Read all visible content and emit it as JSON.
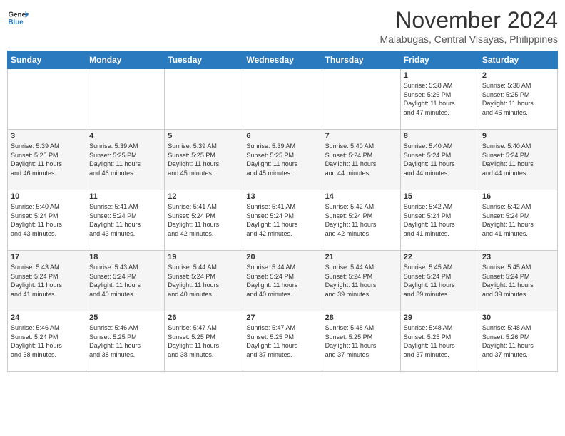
{
  "header": {
    "logo_line1": "General",
    "logo_line2": "Blue",
    "month": "November 2024",
    "location": "Malabugas, Central Visayas, Philippines"
  },
  "days_of_week": [
    "Sunday",
    "Monday",
    "Tuesday",
    "Wednesday",
    "Thursday",
    "Friday",
    "Saturday"
  ],
  "weeks": [
    [
      {
        "day": "",
        "info": ""
      },
      {
        "day": "",
        "info": ""
      },
      {
        "day": "",
        "info": ""
      },
      {
        "day": "",
        "info": ""
      },
      {
        "day": "",
        "info": ""
      },
      {
        "day": "1",
        "info": "Sunrise: 5:38 AM\nSunset: 5:26 PM\nDaylight: 11 hours\nand 47 minutes."
      },
      {
        "day": "2",
        "info": "Sunrise: 5:38 AM\nSunset: 5:25 PM\nDaylight: 11 hours\nand 46 minutes."
      }
    ],
    [
      {
        "day": "3",
        "info": "Sunrise: 5:39 AM\nSunset: 5:25 PM\nDaylight: 11 hours\nand 46 minutes."
      },
      {
        "day": "4",
        "info": "Sunrise: 5:39 AM\nSunset: 5:25 PM\nDaylight: 11 hours\nand 46 minutes."
      },
      {
        "day": "5",
        "info": "Sunrise: 5:39 AM\nSunset: 5:25 PM\nDaylight: 11 hours\nand 45 minutes."
      },
      {
        "day": "6",
        "info": "Sunrise: 5:39 AM\nSunset: 5:25 PM\nDaylight: 11 hours\nand 45 minutes."
      },
      {
        "day": "7",
        "info": "Sunrise: 5:40 AM\nSunset: 5:24 PM\nDaylight: 11 hours\nand 44 minutes."
      },
      {
        "day": "8",
        "info": "Sunrise: 5:40 AM\nSunset: 5:24 PM\nDaylight: 11 hours\nand 44 minutes."
      },
      {
        "day": "9",
        "info": "Sunrise: 5:40 AM\nSunset: 5:24 PM\nDaylight: 11 hours\nand 44 minutes."
      }
    ],
    [
      {
        "day": "10",
        "info": "Sunrise: 5:40 AM\nSunset: 5:24 PM\nDaylight: 11 hours\nand 43 minutes."
      },
      {
        "day": "11",
        "info": "Sunrise: 5:41 AM\nSunset: 5:24 PM\nDaylight: 11 hours\nand 43 minutes."
      },
      {
        "day": "12",
        "info": "Sunrise: 5:41 AM\nSunset: 5:24 PM\nDaylight: 11 hours\nand 42 minutes."
      },
      {
        "day": "13",
        "info": "Sunrise: 5:41 AM\nSunset: 5:24 PM\nDaylight: 11 hours\nand 42 minutes."
      },
      {
        "day": "14",
        "info": "Sunrise: 5:42 AM\nSunset: 5:24 PM\nDaylight: 11 hours\nand 42 minutes."
      },
      {
        "day": "15",
        "info": "Sunrise: 5:42 AM\nSunset: 5:24 PM\nDaylight: 11 hours\nand 41 minutes."
      },
      {
        "day": "16",
        "info": "Sunrise: 5:42 AM\nSunset: 5:24 PM\nDaylight: 11 hours\nand 41 minutes."
      }
    ],
    [
      {
        "day": "17",
        "info": "Sunrise: 5:43 AM\nSunset: 5:24 PM\nDaylight: 11 hours\nand 41 minutes."
      },
      {
        "day": "18",
        "info": "Sunrise: 5:43 AM\nSunset: 5:24 PM\nDaylight: 11 hours\nand 40 minutes."
      },
      {
        "day": "19",
        "info": "Sunrise: 5:44 AM\nSunset: 5:24 PM\nDaylight: 11 hours\nand 40 minutes."
      },
      {
        "day": "20",
        "info": "Sunrise: 5:44 AM\nSunset: 5:24 PM\nDaylight: 11 hours\nand 40 minutes."
      },
      {
        "day": "21",
        "info": "Sunrise: 5:44 AM\nSunset: 5:24 PM\nDaylight: 11 hours\nand 39 minutes."
      },
      {
        "day": "22",
        "info": "Sunrise: 5:45 AM\nSunset: 5:24 PM\nDaylight: 11 hours\nand 39 minutes."
      },
      {
        "day": "23",
        "info": "Sunrise: 5:45 AM\nSunset: 5:24 PM\nDaylight: 11 hours\nand 39 minutes."
      }
    ],
    [
      {
        "day": "24",
        "info": "Sunrise: 5:46 AM\nSunset: 5:24 PM\nDaylight: 11 hours\nand 38 minutes."
      },
      {
        "day": "25",
        "info": "Sunrise: 5:46 AM\nSunset: 5:25 PM\nDaylight: 11 hours\nand 38 minutes."
      },
      {
        "day": "26",
        "info": "Sunrise: 5:47 AM\nSunset: 5:25 PM\nDaylight: 11 hours\nand 38 minutes."
      },
      {
        "day": "27",
        "info": "Sunrise: 5:47 AM\nSunset: 5:25 PM\nDaylight: 11 hours\nand 37 minutes."
      },
      {
        "day": "28",
        "info": "Sunrise: 5:48 AM\nSunset: 5:25 PM\nDaylight: 11 hours\nand 37 minutes."
      },
      {
        "day": "29",
        "info": "Sunrise: 5:48 AM\nSunset: 5:25 PM\nDaylight: 11 hours\nand 37 minutes."
      },
      {
        "day": "30",
        "info": "Sunrise: 5:48 AM\nSunset: 5:26 PM\nDaylight: 11 hours\nand 37 minutes."
      }
    ]
  ]
}
